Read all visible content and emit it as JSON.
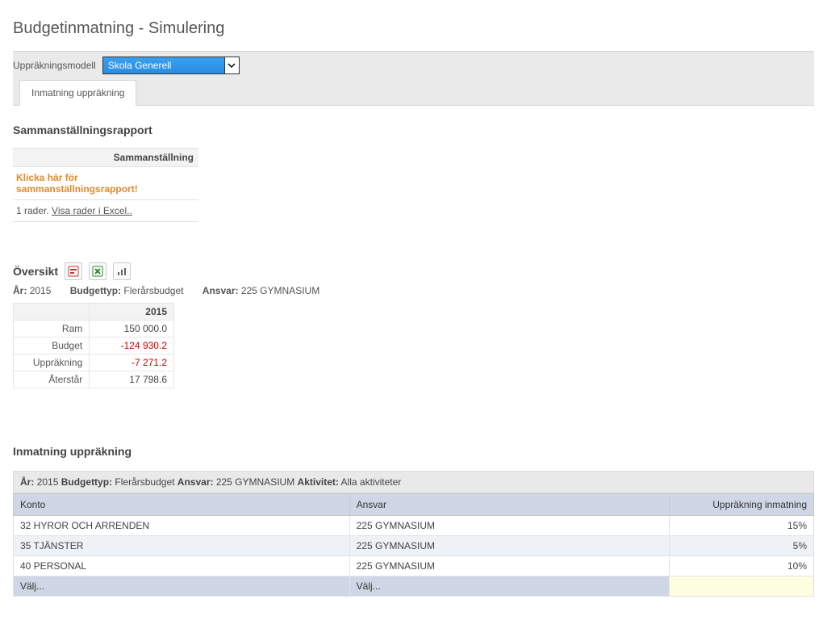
{
  "page_title": "Budgetinmatning - Simulering",
  "model": {
    "label": "Uppräkningsmodell",
    "selected": "Skola Generell"
  },
  "tab": {
    "label": "Inmatning uppräkning"
  },
  "summary": {
    "title": "Sammanställningsrapport",
    "header": "Sammanställning",
    "link_text": "Klicka här för sammanställningsrapport!",
    "rows_text": "1 rader.",
    "excel_text": "Visa rader i Excel.."
  },
  "overview": {
    "title": "Översikt",
    "filter": {
      "year_label": "År:",
      "year": "2015",
      "type_label": "Budgettyp:",
      "type": "Flerårsbudget",
      "resp_label": "Ansvar:",
      "resp": "225 GYMNASIUM"
    },
    "col_year": "2015",
    "rows": [
      {
        "label": "Ram",
        "value": "150 000.0",
        "neg": false
      },
      {
        "label": "Budget",
        "value": "-124 930.2",
        "neg": true
      },
      {
        "label": "Uppräkning",
        "value": "-7 271.2",
        "neg": true
      },
      {
        "label": "Återstår",
        "value": "17 798.6",
        "neg": false
      }
    ]
  },
  "input_section": {
    "title": "Inmatning uppräkning",
    "filter": {
      "year_label": "År:",
      "year": "2015",
      "type_label": "Budgettyp:",
      "type": "Flerårsbudget",
      "resp_label": "Ansvar:",
      "resp": "225 GYMNASIUM",
      "act_label": "Aktivitet:",
      "act": "Alla aktiviteter"
    },
    "columns": {
      "konto": "Konto",
      "ansvar": "Ansvar",
      "upprakning": "Uppräkning inmatning"
    },
    "rows": [
      {
        "konto": "32 HYROR OCH ARRENDEN",
        "ansvar": "225 GYMNASIUM",
        "upprakning": "15%"
      },
      {
        "konto": "35 TJÄNSTER",
        "ansvar": "225 GYMNASIUM",
        "upprakning": "5%"
      },
      {
        "konto": "40 PERSONAL",
        "ansvar": "225 GYMNASIUM",
        "upprakning": "10%"
      }
    ],
    "choose_text": "Välj..."
  }
}
